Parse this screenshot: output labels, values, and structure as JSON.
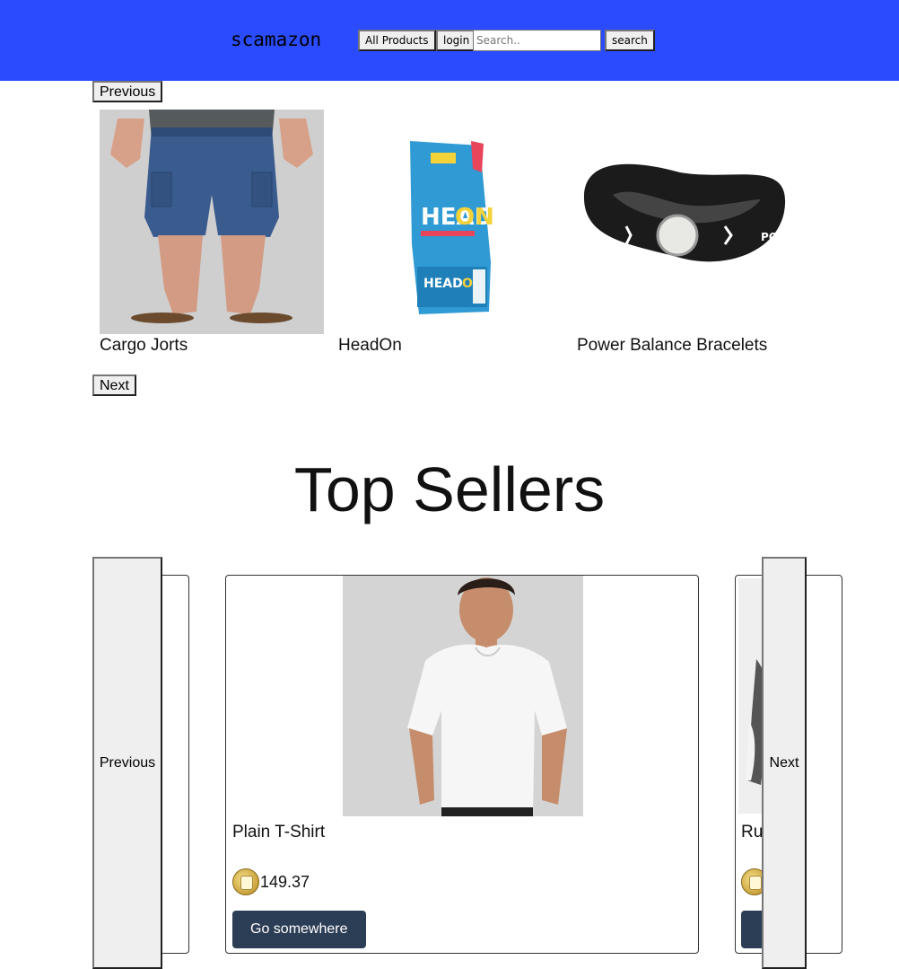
{
  "navbar": {
    "brand": "scamazon",
    "all_products_label": "All Products",
    "login_label": "login",
    "search_placeholder": "Search..",
    "search_button_label": "search",
    "bg_color": "#2a4bff"
  },
  "featured_carousel": {
    "previous_label": "Previous",
    "next_label": "Next",
    "items": [
      {
        "title": "Cargo Jorts",
        "image": "cargo-jorts-photo"
      },
      {
        "title": "HeadOn",
        "image": "headon-package-photo"
      },
      {
        "title": "Power Balance Bracelets",
        "image": "power-balance-bracelet-photo"
      }
    ]
  },
  "top_sellers": {
    "heading": "Top Sellers",
    "previous_label": "Previous",
    "next_label": "Next",
    "cards": [
      {
        "title": "Plain T-Shirt",
        "price": "149.37",
        "button_label": "Go somewhere",
        "currency_icon": "dogecoin-icon"
      },
      {
        "title": "Ru",
        "price": "",
        "button_label": "",
        "currency_icon": "dogecoin-icon"
      }
    ],
    "button_color": "#2c3e55"
  }
}
